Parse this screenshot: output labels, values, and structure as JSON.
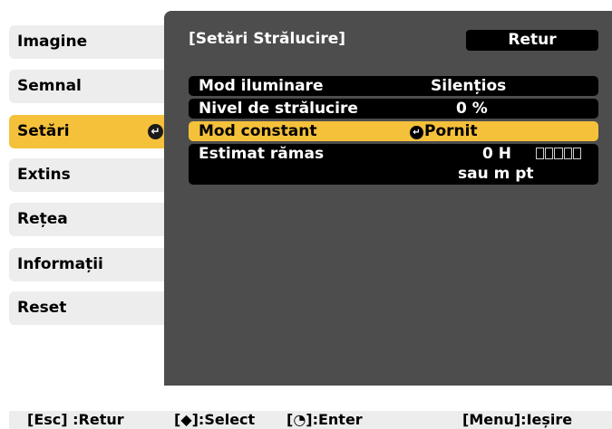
{
  "menu": {
    "items": [
      {
        "label": "Imagine"
      },
      {
        "label": "Semnal"
      },
      {
        "label": "Setări",
        "active": true
      },
      {
        "label": "Extins"
      },
      {
        "label": "Rețea"
      },
      {
        "label": "Informații"
      },
      {
        "label": "Reset"
      }
    ],
    "active_marker_icon": "enter-icon"
  },
  "panel": {
    "title": "[Setări Strălucire]",
    "return_label": "Retur",
    "rows": [
      {
        "label": "Mod iluminare",
        "value": "Silențios"
      },
      {
        "label": "Nivel de strălucire",
        "value": "0 %"
      },
      {
        "label": "Mod constant",
        "value": "Pornit",
        "selected": true,
        "value_icon": "enter-icon"
      },
      {
        "label": "Estimat rămas",
        "hours": "0 H",
        "gauge_icon": "remaining-gauge",
        "subtext": "sau m pt"
      }
    ]
  },
  "footer": {
    "esc": "[Esc] :Retur",
    "select": "[◆]:Select",
    "enter": "[◔]:Enter",
    "menu": "[Menu]:Ieșire"
  },
  "colors": {
    "accent": "#f5c13b",
    "panel_bg": "#4d4d4d",
    "menu_bg": "#ededed",
    "row_bg": "#000000"
  }
}
